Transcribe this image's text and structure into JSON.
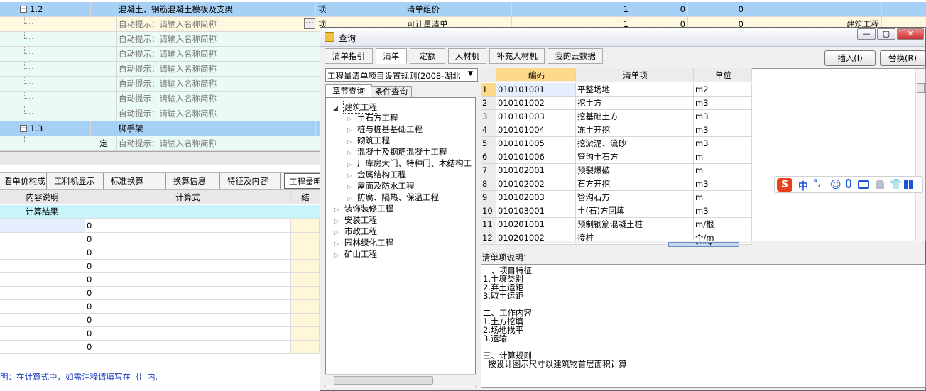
{
  "bill_rows": [
    {
      "num": "1.2",
      "name": "混凝土、钢筋混凝土模板及支架",
      "unit": "项",
      "type": "清单组价",
      "v1": "1",
      "v2": "0",
      "v3": "0"
    },
    {
      "hint": "自动提示：请输入名称简称",
      "unit": "项",
      "type": "可计量清单",
      "v1": "1",
      "v2": "0",
      "v3": "0",
      "extra": "建筑工程"
    },
    {
      "hint": "自动提示：请输入名称简称"
    },
    {
      "hint": "自动提示：请输入名称简称"
    },
    {
      "hint": "自动提示：请输入名称简称"
    },
    {
      "hint": "自动提示：请输入名称简称"
    },
    {
      "hint": "自动提示：请输入名称简称"
    },
    {
      "hint": "自动提示：请输入名称简称"
    },
    {
      "num": "1.3",
      "name": "脚手架"
    },
    {
      "hint": "自动提示：请输入名称简称",
      "col2": "定"
    }
  ],
  "bottom_tabs": [
    "看单价构成",
    "工料机显示",
    "标准换算",
    "换算信息",
    "特征及内容",
    "工程量明细"
  ],
  "grid": {
    "col1": "内容说明",
    "col2": "计算式",
    "col3": "结",
    "result_label": "计算结果",
    "values": [
      "0",
      "0",
      "0",
      "0",
      "0",
      "0",
      "0",
      "0",
      "0",
      "0"
    ]
  },
  "bottom_note": "明：在计算式中，如需注释请填写在｛｝内.",
  "dialog": {
    "title": "查询",
    "tabs": [
      "清单指引",
      "清单",
      "定额",
      "人材机",
      "补充人材机",
      "我的云数据"
    ],
    "insert_label": "插入(I)",
    "replace_label": "替换(R)",
    "rule_select": "工程量清单项目设置规则(2008-湖北",
    "subtabs": [
      "章节查询",
      "条件查询"
    ],
    "tree": {
      "root": "建筑工程",
      "children": [
        "土石方工程",
        "桩与桩基基础工程",
        "砌筑工程",
        "混凝土及钢筋混凝土工程",
        "厂库房大门、特种门、木结构工",
        "金属结构工程",
        "屋面及防水工程",
        "防腐、隔热、保温工程"
      ],
      "others": [
        "装饰装修工程",
        "安装工程",
        "市政工程",
        "园林绿化工程",
        "矿山工程"
      ]
    },
    "table": {
      "headers": [
        "编码",
        "清单项",
        "单位"
      ],
      "rows": [
        [
          "1",
          "010101001",
          "平整场地",
          "m2"
        ],
        [
          "2",
          "010101002",
          "挖土方",
          "m3"
        ],
        [
          "3",
          "010101003",
          "挖基础土方",
          "m3"
        ],
        [
          "4",
          "010101004",
          "冻土开挖",
          "m3"
        ],
        [
          "5",
          "010101005",
          "挖淤泥、流砂",
          "m3"
        ],
        [
          "6",
          "010101006",
          "管沟土石方",
          "m"
        ],
        [
          "7",
          "010102001",
          "预裂爆破",
          "m"
        ],
        [
          "8",
          "010102002",
          "石方开挖",
          "m3"
        ],
        [
          "9",
          "010102003",
          "管沟石方",
          "m"
        ],
        [
          "10",
          "010103001",
          "土(石)方回填",
          "m3"
        ],
        [
          "11",
          "010201001",
          "预制钢筋混凝土桩",
          "m/根"
        ],
        [
          "12",
          "010201002",
          "接桩",
          "个/m"
        ]
      ]
    },
    "desc_label": "清单项说明：",
    "desc_lines": [
      "一、项目特征",
      "1.土壤类别",
      "2.弃土运距",
      "3.取土运距",
      "",
      "二、工作内容",
      "1.土方挖填",
      "2.场地找平",
      "3.运输",
      "",
      "三、计算规则",
      "  按设计图示尺寸以建筑物首层面积计算"
    ]
  },
  "ime": {
    "glyphs": [
      "中",
      "°,"
    ]
  },
  "colors": {
    "selected_row": "#a6d0f5",
    "hint_row": "#eafaf6",
    "accent": "#3370d0",
    "ime_brand": "#e8421c"
  }
}
